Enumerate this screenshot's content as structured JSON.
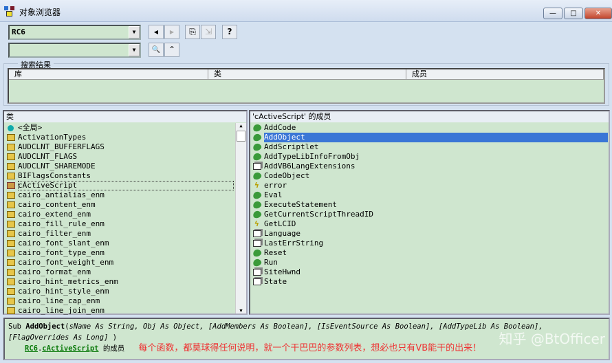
{
  "window": {
    "title": "对象浏览器",
    "min": "—",
    "max": "□",
    "close": "✕"
  },
  "toolbar": {
    "library": "RC6",
    "search": "",
    "back": "◀",
    "forward": "▶",
    "copy": "⎘",
    "view_def": "⇲",
    "help": "?",
    "find": "🔍",
    "collapse": "⌃"
  },
  "search_results": {
    "label": "搜索结果",
    "columns": [
      "库",
      "类",
      "成员"
    ]
  },
  "classes": {
    "header": "类",
    "items": [
      {
        "label": "<全局>",
        "icon": "global"
      },
      {
        "label": "ActivationTypes",
        "icon": "enum"
      },
      {
        "label": "AUDCLNT_BUFFERFLAGS",
        "icon": "enum"
      },
      {
        "label": "AUDCLNT_FLAGS",
        "icon": "enum"
      },
      {
        "label": "AUDCLNT_SHAREMODE",
        "icon": "enum"
      },
      {
        "label": "BIFlagsConstants",
        "icon": "enum"
      },
      {
        "label": "cActiveScript",
        "icon": "class"
      },
      {
        "label": "cairo_antialias_enm",
        "icon": "enum"
      },
      {
        "label": "cairo_content_enm",
        "icon": "enum"
      },
      {
        "label": "cairo_extend_enm",
        "icon": "enum"
      },
      {
        "label": "cairo_fill_rule_enm",
        "icon": "enum"
      },
      {
        "label": "cairo_filter_enm",
        "icon": "enum"
      },
      {
        "label": "cairo_font_slant_enm",
        "icon": "enum"
      },
      {
        "label": "cairo_font_type_enm",
        "icon": "enum"
      },
      {
        "label": "cairo_font_weight_enm",
        "icon": "enum"
      },
      {
        "label": "cairo_format_enm",
        "icon": "enum"
      },
      {
        "label": "cairo_hint_metrics_enm",
        "icon": "enum"
      },
      {
        "label": "cairo_hint_style_enm",
        "icon": "enum"
      },
      {
        "label": "cairo_line_cap_enm",
        "icon": "enum"
      },
      {
        "label": "cairo_line_join_enm",
        "icon": "enum"
      }
    ]
  },
  "members": {
    "header": "'cActiveScript' 的成员",
    "items": [
      {
        "label": "AddCode",
        "icon": "method"
      },
      {
        "label": "AddObject",
        "icon": "method"
      },
      {
        "label": "AddScriptlet",
        "icon": "method"
      },
      {
        "label": "AddTypeLibInfoFromObj",
        "icon": "method"
      },
      {
        "label": "AddVB6LangExtensions",
        "icon": "property"
      },
      {
        "label": "CodeObject",
        "icon": "method"
      },
      {
        "label": "error",
        "icon": "event"
      },
      {
        "label": "Eval",
        "icon": "method"
      },
      {
        "label": "ExecuteStatement",
        "icon": "method"
      },
      {
        "label": "GetCurrentScriptThreadID",
        "icon": "method"
      },
      {
        "label": "GetLCID",
        "icon": "event"
      },
      {
        "label": "Language",
        "icon": "property"
      },
      {
        "label": "LastErrString",
        "icon": "property"
      },
      {
        "label": "Reset",
        "icon": "method"
      },
      {
        "label": "Run",
        "icon": "method"
      },
      {
        "label": "SiteHwnd",
        "icon": "property"
      },
      {
        "label": "State",
        "icon": "property"
      }
    ]
  },
  "details": {
    "kind": "Sub",
    "name": "AddObject",
    "open": "(",
    "params": [
      "sName As String,",
      "Obj As Object,",
      "[AddMembers As Boolean],",
      "[IsEventSource As Boolean],",
      "[AddTypeLib As Boolean],",
      "[FlagOverrides As Long]"
    ],
    "close": ")",
    "lib": "RC6",
    "dot": ".",
    "cls": "cActiveScript",
    "member_of": "的成员",
    "note": "每个函数，都莫球得任何说明，就一个干巴巴的参数列表，想必也只有VB能干的出来！"
  },
  "watermark": "知乎 @BtOfficer"
}
